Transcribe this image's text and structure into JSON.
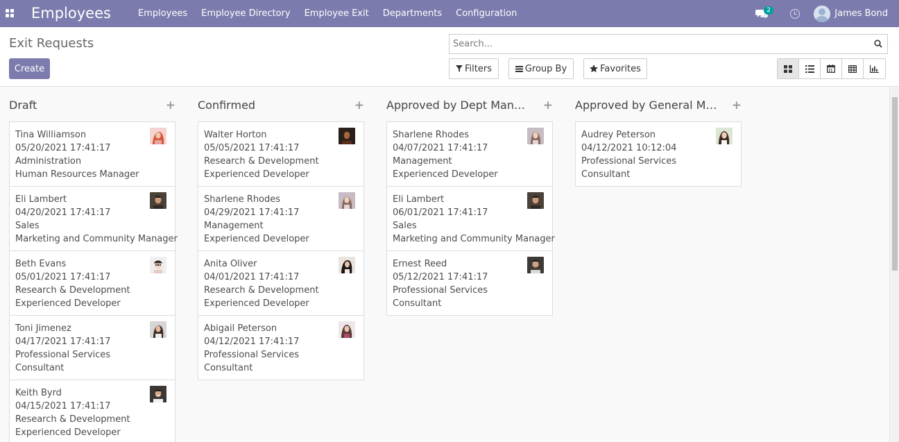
{
  "nav": {
    "brand": "Employees",
    "menu": [
      "Employees",
      "Employee Directory",
      "Employee Exit",
      "Departments",
      "Configuration"
    ],
    "chat_count": "2",
    "user": "James Bond"
  },
  "control": {
    "title": "Exit Requests",
    "create": "Create",
    "search_placeholder": "Search...",
    "filters": "Filters",
    "group_by": "Group By",
    "favorites": "Favorites"
  },
  "columns": [
    {
      "title": "Draft",
      "cards": [
        {
          "name": "Tina Williamson",
          "date": "05/20/2021 17:41:17",
          "dept": "Administration",
          "job": "Human Resources Manager"
        },
        {
          "name": "Eli Lambert",
          "date": "04/20/2021 17:41:17",
          "dept": "Sales",
          "job": "Marketing and Community Manager"
        },
        {
          "name": "Beth Evans",
          "date": "05/01/2021 17:41:17",
          "dept": "Research & Development",
          "job": "Experienced Developer"
        },
        {
          "name": "Toni Jimenez",
          "date": "04/17/2021 17:41:17",
          "dept": "Professional Services",
          "job": "Consultant"
        },
        {
          "name": "Keith Byrd",
          "date": "04/15/2021 17:41:17",
          "dept": "Research & Development",
          "job": "Experienced Developer"
        }
      ]
    },
    {
      "title": "Confirmed",
      "cards": [
        {
          "name": "Walter Horton",
          "date": "05/05/2021 17:41:17",
          "dept": "Research & Development",
          "job": "Experienced Developer"
        },
        {
          "name": "Sharlene Rhodes",
          "date": "04/29/2021 17:41:17",
          "dept": "Management",
          "job": "Experienced Developer"
        },
        {
          "name": "Anita Oliver",
          "date": "04/01/2021 17:41:17",
          "dept": "Research & Development",
          "job": "Experienced Developer"
        },
        {
          "name": "Abigail Peterson",
          "date": "04/12/2021 17:41:17",
          "dept": "Professional Services",
          "job": "Consultant"
        }
      ]
    },
    {
      "title": "Approved by Dept Manager",
      "cards": [
        {
          "name": "Sharlene Rhodes",
          "date": "04/07/2021 17:41:17",
          "dept": "Management",
          "job": "Experienced Developer"
        },
        {
          "name": "Eli Lambert",
          "date": "06/01/2021 17:41:17",
          "dept": "Sales",
          "job": "Marketing and Community Manager"
        },
        {
          "name": "Ernest Reed",
          "date": "05/12/2021 17:41:17",
          "dept": "Professional Services",
          "job": "Consultant"
        }
      ]
    },
    {
      "title": "Approved by General Man...",
      "cards": [
        {
          "name": "Audrey Peterson",
          "date": "04/12/2021 10:12:04",
          "dept": "Professional Services",
          "job": "Consultant"
        }
      ]
    }
  ],
  "colors": {
    "navbar": "#7c7bad",
    "accent": "#00a09d"
  }
}
